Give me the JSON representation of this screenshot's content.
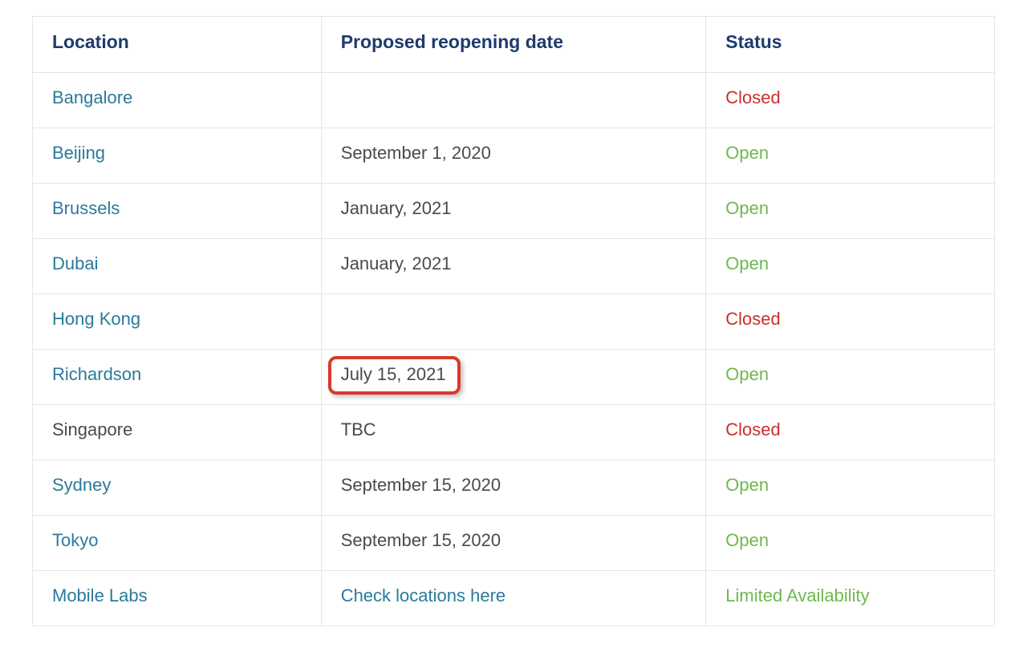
{
  "table": {
    "headers": {
      "location": "Location",
      "date": "Proposed reopening date",
      "status": "Status"
    },
    "rows": [
      {
        "location": "Bangalore",
        "location_link": true,
        "date": "",
        "date_link": false,
        "date_highlight": false,
        "status": "Closed",
        "status_class": "status-closed"
      },
      {
        "location": "Beijing",
        "location_link": true,
        "date": "September 1, 2020",
        "date_link": false,
        "date_highlight": false,
        "status": "Open",
        "status_class": "status-open"
      },
      {
        "location": "Brussels",
        "location_link": true,
        "date": "January, 2021",
        "date_link": false,
        "date_highlight": false,
        "status": "Open",
        "status_class": "status-open"
      },
      {
        "location": "Dubai",
        "location_link": true,
        "date": "January, 2021",
        "date_link": false,
        "date_highlight": false,
        "status": "Open",
        "status_class": "status-open"
      },
      {
        "location": "Hong Kong",
        "location_link": true,
        "date": "",
        "date_link": false,
        "date_highlight": false,
        "status": "Closed",
        "status_class": "status-closed"
      },
      {
        "location": "Richardson",
        "location_link": true,
        "date": "July 15, 2021",
        "date_link": false,
        "date_highlight": true,
        "status": "Open",
        "status_class": "status-open"
      },
      {
        "location": "Singapore",
        "location_link": false,
        "date": "TBC",
        "date_link": false,
        "date_highlight": false,
        "status": "Closed",
        "status_class": "status-closed"
      },
      {
        "location": "Sydney",
        "location_link": true,
        "date": "September 15, 2020",
        "date_link": false,
        "date_highlight": false,
        "status": "Open",
        "status_class": "status-open"
      },
      {
        "location": "Tokyo",
        "location_link": true,
        "date": "September 15, 2020",
        "date_link": false,
        "date_highlight": false,
        "status": "Open",
        "status_class": "status-open"
      },
      {
        "location": "Mobile Labs",
        "location_link": true,
        "date": "Check locations here",
        "date_link": true,
        "date_highlight": false,
        "status": "Limited Availability",
        "status_class": "status-limited"
      }
    ]
  }
}
